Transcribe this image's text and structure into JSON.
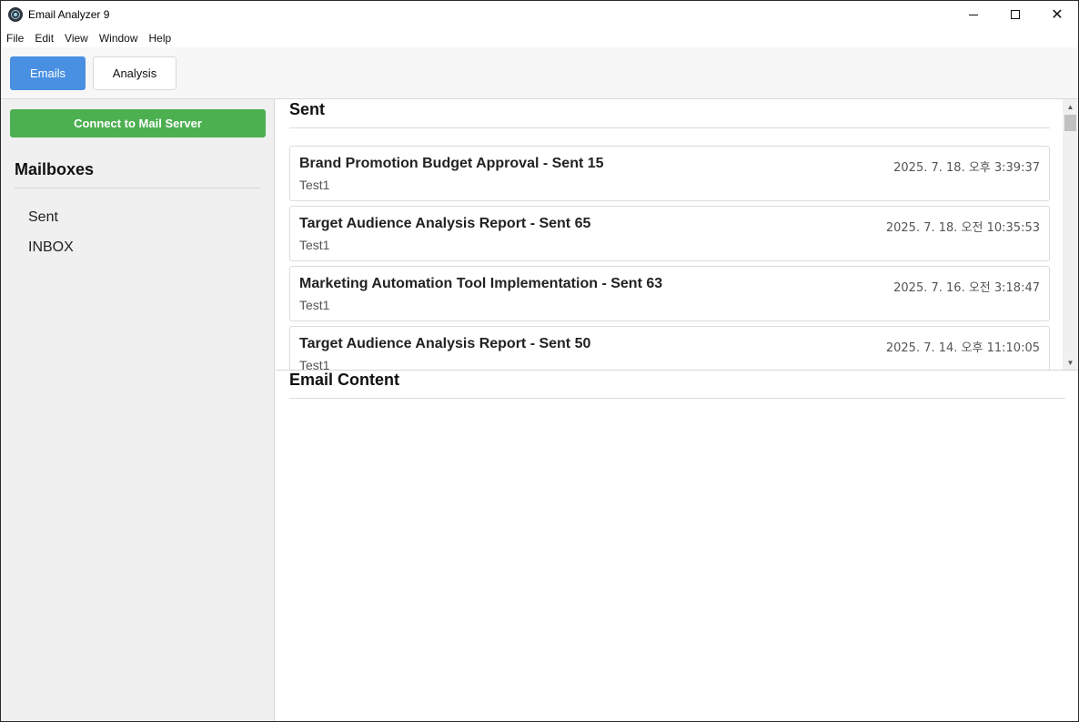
{
  "window": {
    "title": "Email Analyzer 9",
    "controls": {
      "minimize": "minimize",
      "maximize": "maximize",
      "close": "✕"
    }
  },
  "menu": [
    "File",
    "Edit",
    "View",
    "Window",
    "Help"
  ],
  "tabs": [
    {
      "label": "Emails",
      "active": true
    },
    {
      "label": "Analysis",
      "active": false
    }
  ],
  "sidebar": {
    "connect_label": "Connect to Mail Server",
    "heading": "Mailboxes",
    "mailboxes": [
      "Sent",
      "INBOX"
    ]
  },
  "main": {
    "list_title": "Sent",
    "emails": [
      {
        "subject": "Brand Promotion Budget Approval - Sent 15",
        "from": "Test1",
        "date": "2025. 7. 18. 오후 3:39:37"
      },
      {
        "subject": "Target Audience Analysis Report - Sent 65",
        "from": "Test1",
        "date": "2025. 7. 18. 오전 10:35:53"
      },
      {
        "subject": "Marketing Automation Tool Implementation - Sent 63",
        "from": "Test1",
        "date": "2025. 7. 16. 오전 3:18:47"
      },
      {
        "subject": "Target Audience Analysis Report - Sent 50",
        "from": "Test1",
        "date": "2025. 7. 14. 오후 11:10:05"
      }
    ],
    "content_title": "Email Content"
  },
  "colors": {
    "tab_active": "#4a90e2",
    "connect_button": "#4caf50",
    "sidebar_bg": "#f0f0f0"
  }
}
